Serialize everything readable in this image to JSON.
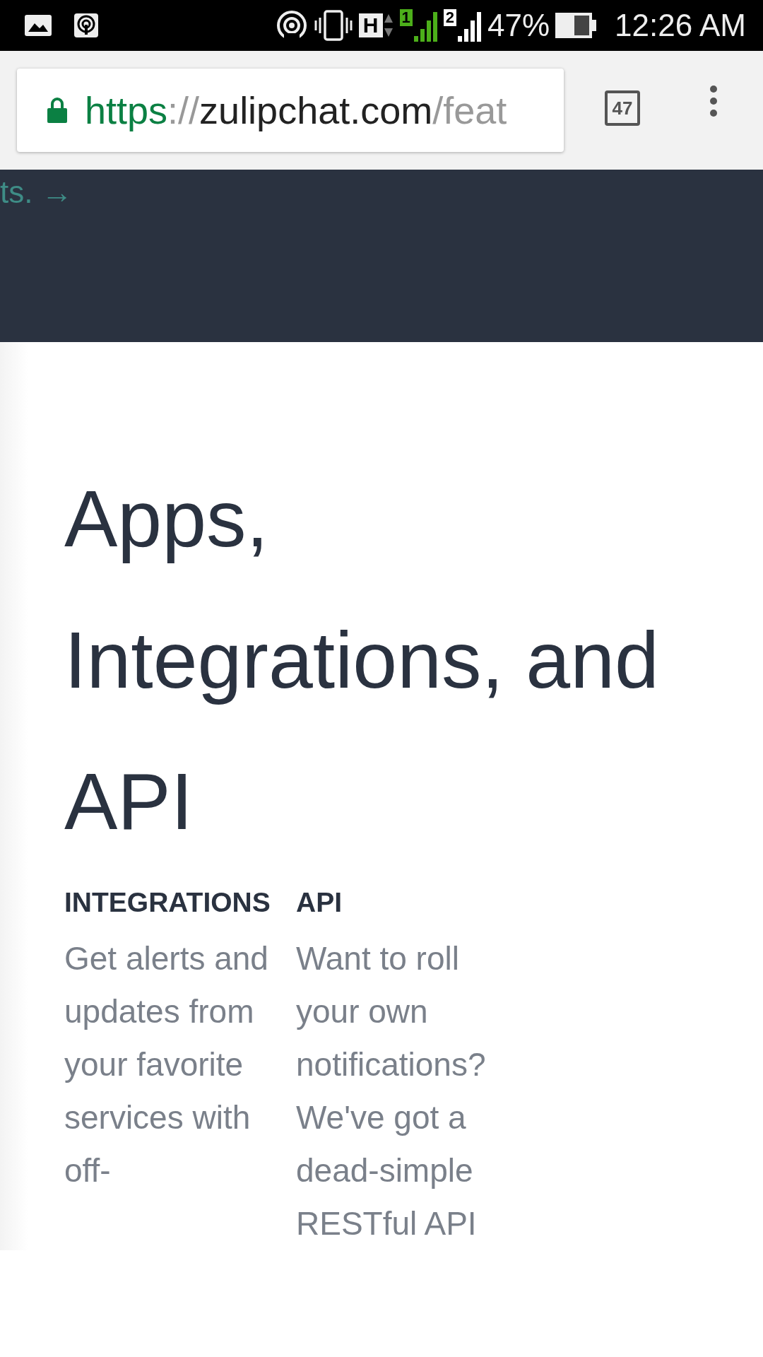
{
  "status_bar": {
    "network_type": "H",
    "sims": [
      {
        "label": "1",
        "color": "#4caf1a"
      },
      {
        "label": "2",
        "color": "#ffffff"
      }
    ],
    "battery_text": "47%",
    "time": "12:26 AM"
  },
  "address_bar": {
    "scheme": "https",
    "separator": "://",
    "host": "zulipchat.com",
    "path": "/feat",
    "tab_count": "47"
  },
  "banner": {
    "link_text": "ts. →"
  },
  "heading": "Apps, Integrations, and API",
  "features": [
    {
      "title": "INTEGRATIONS",
      "text": "Get alerts and updates from your favorite services with off-"
    },
    {
      "title": "API",
      "text": "Want to roll your own notifications? We've got a dead-simple RESTful API"
    }
  ]
}
